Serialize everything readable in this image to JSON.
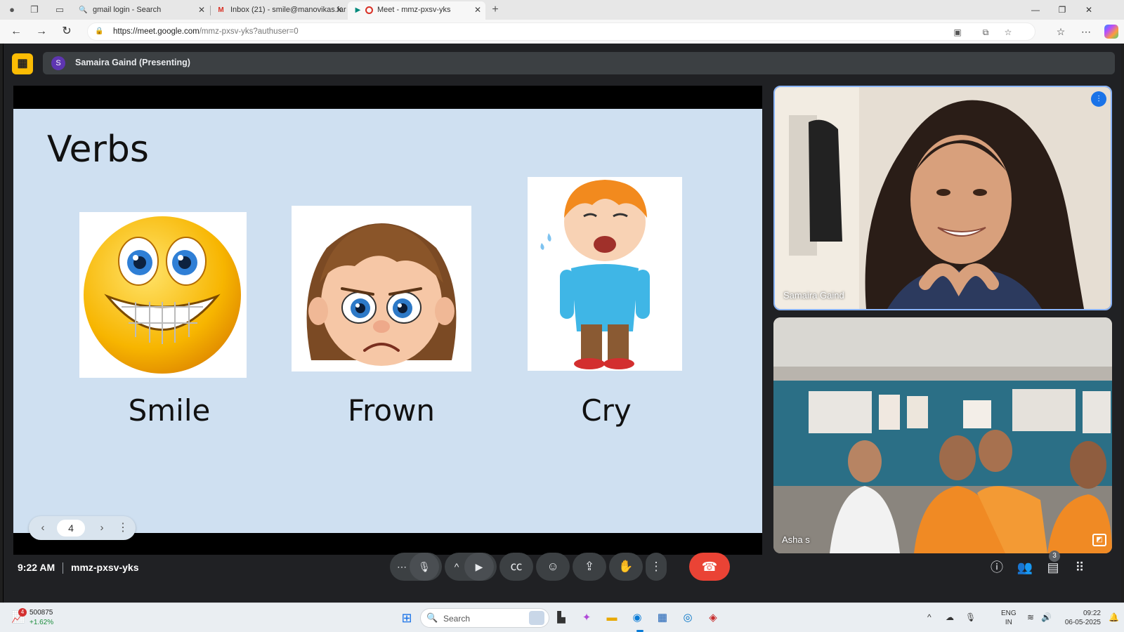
{
  "browser": {
    "tabs": [
      {
        "title": "gmail login - Search",
        "icon": "search-icon",
        "active": false
      },
      {
        "title": "Inbox (21) - smile@manovikas.far",
        "icon": "gmail-icon",
        "active": false
      },
      {
        "title": "Meet - mmz-pxsv-yks",
        "icon": "meet-icon",
        "active": true
      }
    ],
    "url_host": "https://meet.google.com",
    "url_path": "/mmz-pxsv-yks?authuser=0"
  },
  "meet": {
    "presenter_initial": "S",
    "presenter_label": "Samaira Gaind (Presenting)",
    "slide": {
      "title": "Verbs",
      "cards": [
        {
          "caption": "Smile",
          "image": "smiling-emoji"
        },
        {
          "caption": "Frown",
          "image": "frowning-girl"
        },
        {
          "caption": "Cry",
          "image": "crying-boy"
        }
      ],
      "page_number": "4"
    },
    "participants": [
      {
        "name": "Samaira Gaind",
        "speaking": true
      },
      {
        "name": "Asha s",
        "speaking": false
      }
    ],
    "time": "9:22 AM",
    "meeting_code": "mmz-pxsv-yks",
    "people_count": "3",
    "colors": {
      "accent": "#8ab4f8",
      "end_call": "#ea4335",
      "present_badge": "#fbbc04",
      "slide_bg": "#cfe0f1"
    }
  },
  "taskbar": {
    "stock_badge": "4",
    "stock_value": "500875",
    "stock_change": "+1.62%",
    "search_placeholder": "Search",
    "lang_line1": "ENG",
    "lang_line2": "IN",
    "clock_time": "09:22",
    "clock_date": "06-05-2025"
  }
}
